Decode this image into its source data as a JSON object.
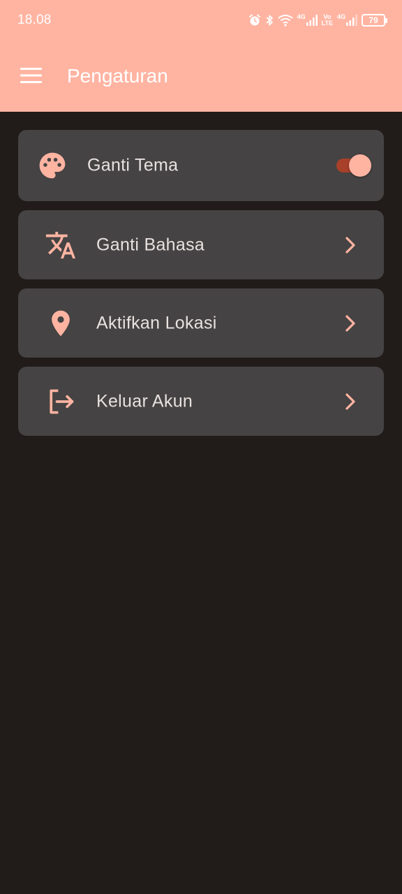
{
  "status_bar": {
    "time": "18.08",
    "network_label_1": "4G",
    "volte_label_top": "Vo",
    "volte_label_bottom": "LTE",
    "network_label_2": "4G",
    "battery": "79"
  },
  "app_bar": {
    "title": "Pengaturan",
    "menu_icon": "hamburger-menu-icon"
  },
  "settings": {
    "items": [
      {
        "label": "Ganti Tema",
        "icon": "palette-icon",
        "control": "toggle",
        "toggle_on": true
      },
      {
        "label": "Ganti Bahasa",
        "icon": "translate-icon",
        "control": "chevron"
      },
      {
        "label": "Aktifkan Lokasi",
        "icon": "location-pin-icon",
        "control": "chevron"
      },
      {
        "label": "Keluar Akun",
        "icon": "logout-icon",
        "control": "chevron"
      }
    ]
  },
  "colors": {
    "primary": "#ffb4a2",
    "background": "#211c1a",
    "card": "#454343",
    "text": "#e8e2e1",
    "toggle_track": "#a8402a"
  }
}
